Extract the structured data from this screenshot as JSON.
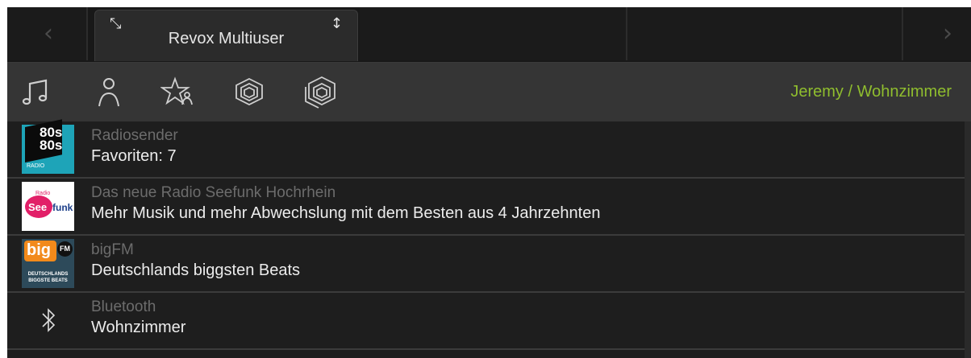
{
  "tabbar": {
    "prev_arrow": "‹",
    "next_arrow": "›",
    "active_tab": "Revox Multiuser"
  },
  "toolbar": {
    "icons": [
      "music-note-icon",
      "user-icon",
      "favorites-icon",
      "room-icon",
      "rooms-group-icon"
    ],
    "user_room": "Jeremy / Wohnzimmer",
    "accent_color": "#8fbd2e"
  },
  "list": {
    "items": [
      {
        "title": "Radiosender",
        "subtitle": "Favoriten: 7",
        "logo": "80s80s-radio-logo",
        "logo_text_1": "80s",
        "logo_text_2": "80s",
        "logo_text_3": "RADIO"
      },
      {
        "title": "Das neue Radio Seefunk Hochrhein",
        "subtitle": "Mehr Musik und mehr Abwechslung mit dem Besten aus 4 Jahrzehnten",
        "logo": "seefunk-logo",
        "logo_text_1": "See",
        "logo_text_2": "funk",
        "logo_text_3": "Radio"
      },
      {
        "title": "bigFM",
        "subtitle": "Deutschlands biggsten Beats",
        "logo": "bigfm-logo",
        "logo_text_1": "big",
        "logo_text_2": "FM",
        "logo_text_3": "DEUTSCHLANDS",
        "logo_text_4": "BIGGSTE BEATS"
      },
      {
        "title": "Bluetooth",
        "subtitle": "Wohnzimmer",
        "logo": "bluetooth-icon"
      }
    ]
  }
}
